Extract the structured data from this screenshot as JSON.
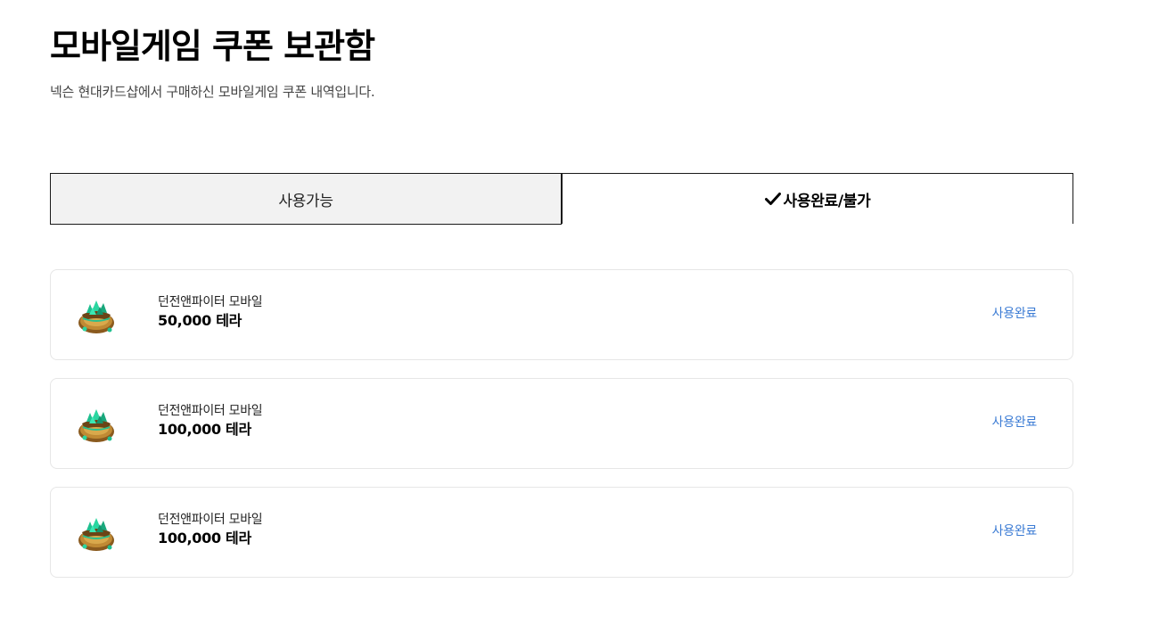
{
  "header": {
    "title": "모바일게임 쿠폰 보관함",
    "subtitle": "넥슨 현대카드샵에서 구매하신 모바일게임 쿠폰 내역입니다."
  },
  "tabs": [
    {
      "label": "사용가능",
      "active": false
    },
    {
      "label": "사용완료/불가",
      "active": true,
      "icon": "check-icon"
    }
  ],
  "coupons": [
    {
      "icon": "gem-bag-icon",
      "game": "던전앤파이터 모바일",
      "amount": "50,000 테라",
      "status": "사용완료"
    },
    {
      "icon": "gem-bag-icon",
      "game": "던전앤파이터 모바일",
      "amount": "100,000 테라",
      "status": "사용완료"
    },
    {
      "icon": "gem-bag-icon",
      "game": "던전앤파이터 모바일",
      "amount": "100,000 테라",
      "status": "사용완료"
    }
  ],
  "colors": {
    "status_link": "#3b7bd4",
    "tab_inactive_bg": "#f2f2f2",
    "card_border": "#e6e6e6"
  }
}
